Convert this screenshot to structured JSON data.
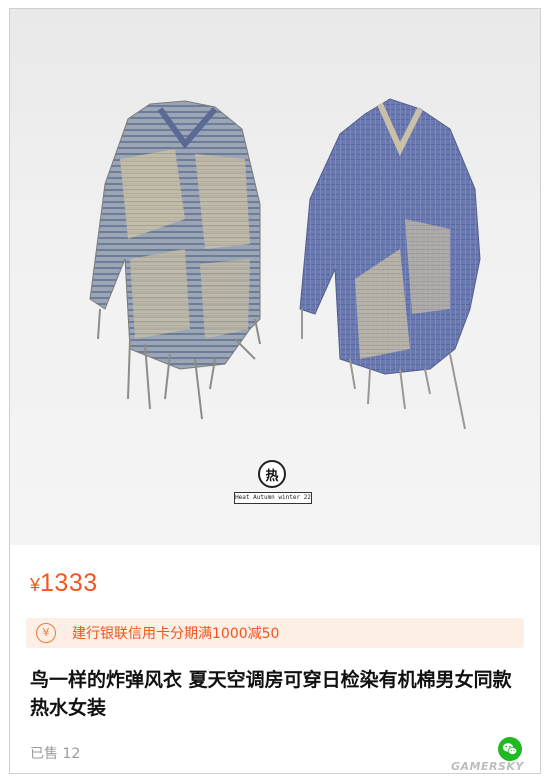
{
  "product": {
    "badge_char": "热",
    "tag_text": "Heat Autumn winter 22",
    "price_symbol": "¥",
    "price": "1333",
    "promo": {
      "icon": "yen-coin-icon",
      "icon_glyph": "¥",
      "text": "建行银联信用卡分期满1000减50"
    },
    "title": "鸟一样的炸弹风衣  夏天空调房可穿日检染有机棉男女同款热水女装",
    "sold": "已售 12",
    "share_icon": "wechat-icon"
  },
  "watermark": "GAMERSKY",
  "colors": {
    "accent": "#f0561f",
    "promo_bg": "#fdeee6",
    "wechat_green": "#1fb922"
  }
}
